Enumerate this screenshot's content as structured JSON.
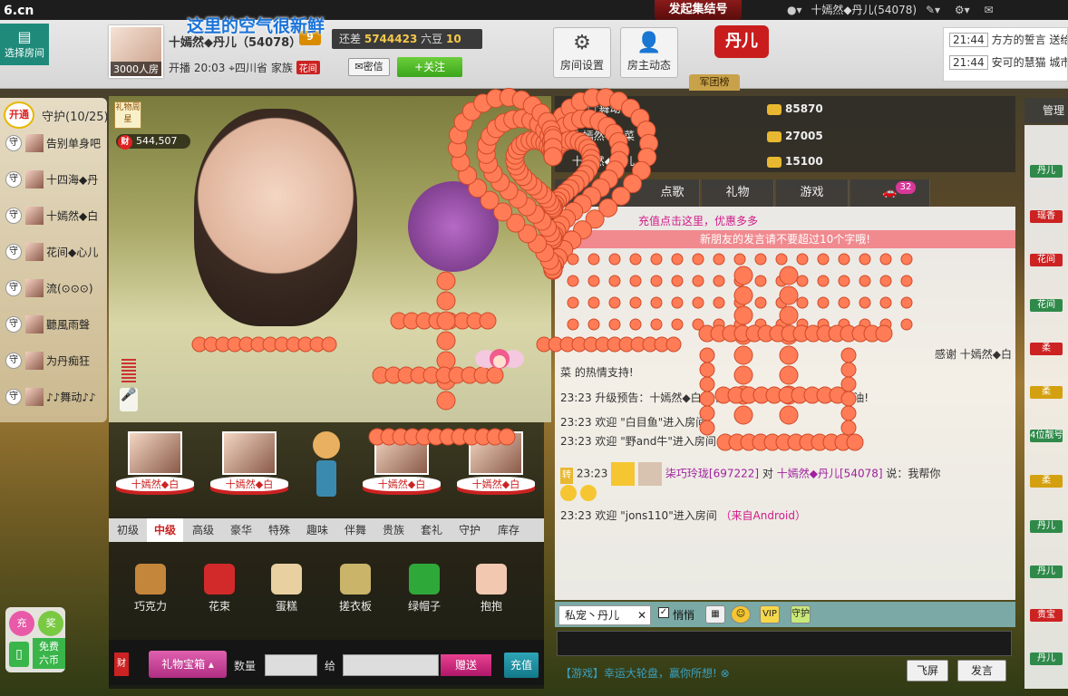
{
  "site": {
    "logo_main": "6",
    "logo_suffix": ".cn",
    "slogan": "这里的空气很新鲜",
    "gang_button": "发起集结号"
  },
  "top_right": {
    "user": "十嫣然◆丹儿(54078)"
  },
  "header": {
    "choose_room": "选择房间",
    "host_name": "十嫣然◆丹儿（54078）",
    "host_level": "9",
    "room_caption": "3000人房",
    "gap_label": "还差",
    "gap_value": "5744423",
    "gap_unit": "六豆",
    "gap_level": "10",
    "broadcast_label": "开播",
    "broadcast_time": "20:03",
    "location": "四川省",
    "family_label": "家族",
    "family_tag": "花间",
    "msg_button": "密信",
    "follow_button": "+关注",
    "room_settings": "房间设置",
    "host_dynamics": "房主动态",
    "brand_badge": "丹儿",
    "army_tab": "军团榜"
  },
  "top_chat": [
    {
      "time": "21:44",
      "text": "方方的誓言 送给"
    },
    {
      "time": "21:44",
      "text": "安可的慧猫 城市"
    }
  ],
  "guard": {
    "open_badge": "开通",
    "title": "守护(10/25)",
    "rows": [
      {
        "tag": "守",
        "name": "告别单身吧"
      },
      {
        "tag": "守",
        "name": "十四海◆丹"
      },
      {
        "tag": "守",
        "name": "十嫣然◆白"
      },
      {
        "tag": "守",
        "name": "花间◆心儿"
      },
      {
        "tag": "守",
        "name": "流(⊙⊙⊙)"
      },
      {
        "tag": "守",
        "name": "聽風雨聲"
      },
      {
        "tag": "守",
        "name": "为丹痴狂"
      },
      {
        "tag": "守",
        "name": "♪♪舞动♪♪"
      }
    ]
  },
  "video": {
    "gift_week": "礼物周星",
    "fortune_tag": "财",
    "fortune_value": "544,507"
  },
  "stage": {
    "pedestals": [
      "十嫣然◆白",
      "十嫣然◆白",
      "十嫣然◆白",
      "十嫣然◆白"
    ]
  },
  "gift_tabs": [
    "初级",
    "中级",
    "高级",
    "豪华",
    "特殊",
    "趣味",
    "伴舞",
    "贵族",
    "套礼",
    "守护",
    "库存"
  ],
  "gift_items": [
    {
      "name": "巧克力",
      "color": "#c4863a"
    },
    {
      "name": "花束",
      "color": "#d22a2a"
    },
    {
      "name": "蛋糕",
      "color": "#e8d0a0"
    },
    {
      "name": "搓衣板",
      "color": "#c9b46a"
    },
    {
      "name": "绿帽子",
      "color": "#2fa83a"
    },
    {
      "name": "抱抱",
      "color": "#f2c9b0"
    }
  ],
  "gift_bottom": {
    "red_tag": "财",
    "giftbox": "礼物宝箱",
    "qty_label": "数量",
    "to_label": "给",
    "send": "赠送",
    "recharge": "充值"
  },
  "mini": {
    "charge": "充",
    "prize": "奖",
    "free": "免费",
    "coins": "六币"
  },
  "rank": [
    {
      "name": "♪♪舞动♪♪",
      "value": "85870"
    },
    {
      "name": "十嫣然◆白菜",
      "value": "27005"
    },
    {
      "name": "十嫣然◆丹儿",
      "value": "15100"
    }
  ],
  "chat_tabs": [
    "点歌",
    "礼物",
    "游戏"
  ],
  "car_count": "32",
  "chat": {
    "promo": "充值点击这里，优惠多多",
    "pink_notice": "新朋友的发言请不要超过10个字哦!",
    "lines": [
      {
        "text": "感谢 十嫣然◆白"
      },
      {
        "text": "菜 的热情支持!"
      },
      {
        "time": "23:23",
        "text": "升级预告：十嫣然◆白菜 距",
        "tail": "继续加油!"
      },
      {
        "time": "23:23",
        "text": "欢迎 \"白目鱼\"进入房间"
      },
      {
        "time": "23:23",
        "text": "欢迎 \"野and牛\"进入房间"
      },
      {
        "time": "23:23",
        "tag": "转",
        "sender": "柒巧玲珑",
        "sender_id": "[697222]",
        "to": "对",
        "target": "十嫣然◆丹儿",
        "target_id": "[54078]",
        "said": "说：我帮你"
      },
      {
        "time": "23:23",
        "text": "欢迎 \"jons110\"进入房间",
        "pink": "（来自Android）"
      }
    ]
  },
  "chat_toolbar": {
    "private": "私宠丶丹儿",
    "quiet": "悄悄",
    "vip": "VIP",
    "guard": "守护"
  },
  "chat_bottom": {
    "game_promo": "【游戏】幸运大轮盘，赢你所想!",
    "fly": "飞屏",
    "send": "发言"
  },
  "right": {
    "manage_tab": "管理",
    "badges": [
      {
        "text": "丹儿",
        "color": "#2f8a4a"
      },
      {
        "text": "瑶香",
        "color": "#c22"
      },
      {
        "text": "花间",
        "color": "#c22"
      },
      {
        "text": "花间",
        "color": "#2f8a4a"
      },
      {
        "text": "柔",
        "color": "#c22"
      },
      {
        "text": "柔",
        "color": "#d4a010"
      },
      {
        "text": "4位靓号",
        "color": "#2f8a4a"
      },
      {
        "text": "柔",
        "color": "#d4a010"
      },
      {
        "text": "丹儿",
        "color": "#2f8a4a"
      },
      {
        "text": "丹儿",
        "color": "#2f8a4a"
      },
      {
        "text": "贵宝",
        "color": "#c22"
      },
      {
        "text": "丹儿",
        "color": "#2f8a4a"
      }
    ]
  },
  "colors": {
    "accent": "#c22",
    "teal": "#1f8a7a",
    "pink": "#d21a8a",
    "heart": "#ff7c56"
  }
}
